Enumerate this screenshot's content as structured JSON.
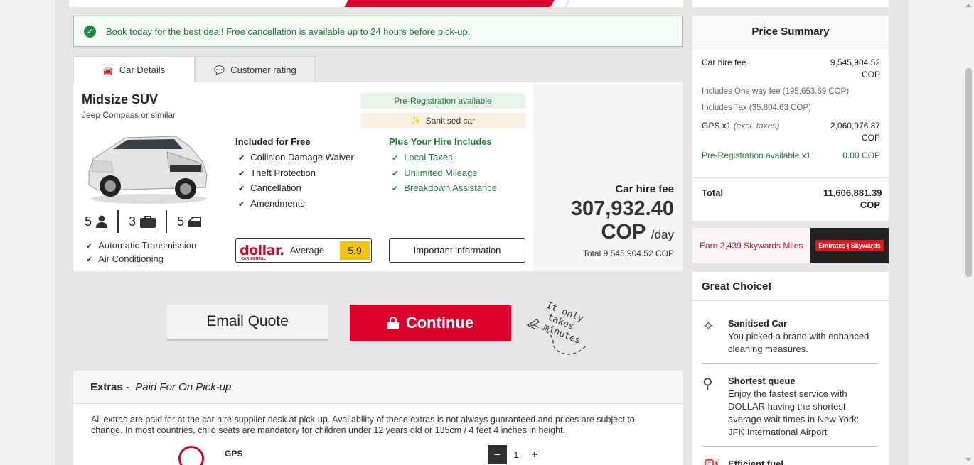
{
  "promo": {
    "text": "Book today for the best deal! Free cancellation is available up to 24 hours before pick-up."
  },
  "tabs": [
    {
      "label": "Car Details"
    },
    {
      "label": "Customer rating"
    }
  ],
  "car": {
    "title": "Midsize SUV",
    "subtitle": "Jeep Compass or similar",
    "seats": "5",
    "bags": "3",
    "doors": "5",
    "features": [
      "Automatic Transmission",
      "Air Conditioning"
    ],
    "badge_prereg": "Pre-Registration available",
    "badge_sanitised": "Sanitised car",
    "included_title": "Included for Free",
    "included": [
      "Collision Damage Waiver",
      "Theft Protection",
      "Cancellation",
      "Amendments"
    ],
    "plus_title": "Plus Your Hire Includes",
    "plus": [
      "Local Taxes",
      "Unlimited Mileage",
      "Breakdown Assistance"
    ],
    "supplier_logo": "dollar.",
    "supplier_logo_sub": "CAR RENTAL",
    "rating_label": "Average",
    "rating_score": "5.9",
    "info_button": "Important information",
    "price_label": "Car hire fee",
    "price_amount": "307,932.40",
    "price_currency": "COP",
    "price_per": "/day",
    "price_total": "Total 9,545,904.52 COP"
  },
  "actions": {
    "email_quote": "Email Quote",
    "continue": "Continue",
    "note_line1": "It only takes",
    "note_line2": "2 minutes"
  },
  "extras": {
    "title": "Extras",
    "title_sep": " - ",
    "subtitle": "Paid For On Pick-up",
    "description": "All extras are paid for at the car hire supplier desk at pick-up. Availability of these extras is not always guaranteed and prices are subject to change. In most countries, child seats are mandatory for children under 12 years old or 135cm / 4 feet 4 inches in height.",
    "gps_title": "GPS",
    "gps_qty": "1",
    "minus": "−",
    "plus": "+"
  },
  "summary": {
    "title": "Price Summary",
    "rows": [
      {
        "label": "Car hire fee",
        "value": "9,545,904.52 COP"
      },
      {
        "label": "Includes One way fee (195,653.69 COP)",
        "value": ""
      },
      {
        "label": "Includes Tax (35,804.63 COP)",
        "value": ""
      },
      {
        "label": "GPS x1",
        "label_note": "(excl. taxes)",
        "value": "2,060,976.87 COP"
      },
      {
        "label": "Pre-Registration available x1",
        "value": "0.00 COP"
      }
    ],
    "total_label": "Total",
    "total_value": "11,606,881.39 COP"
  },
  "skywards": {
    "text": "Earn 2,439 Skywards Miles",
    "logo": "Emirates | Skywards"
  },
  "great_choice": {
    "title": "Great Choice!",
    "items": [
      {
        "title": "Sanitised Car",
        "text": "You picked a brand with enhanced cleaning measures."
      },
      {
        "title": "Shortest queue",
        "text": "Enjoy the fastest service with DOLLAR having the shortest average wait times in New York: JFK International Airport"
      },
      {
        "title": "Efficient fuel",
        "text": ""
      }
    ]
  },
  "colors": {
    "brand_red": "#d9002b",
    "success_green": "#1e7b3a",
    "rating_yellow": "#f2c314"
  }
}
